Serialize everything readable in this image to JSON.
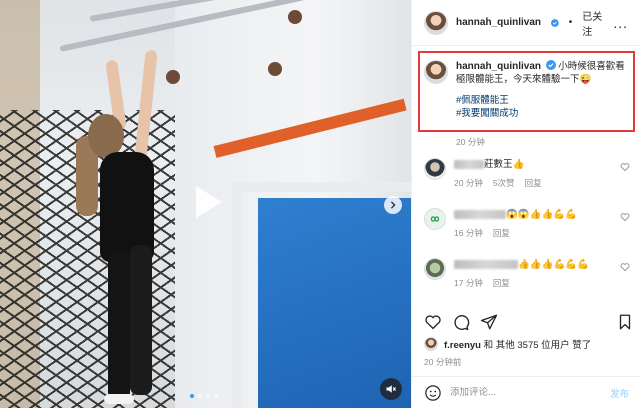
{
  "header": {
    "username": "hannah_quinlivan",
    "separator": "•",
    "follow_status": "已关注",
    "more": "..."
  },
  "caption": {
    "username": "hannah_quinlivan",
    "text": "小時候很喜歡看極限體能王，今天來體驗一下😜",
    "hashtags": [
      "#佩服體能王",
      "#我要闖關成功"
    ],
    "time": "20 分钟"
  },
  "comments": [
    {
      "text_suffix": "莊數王👍",
      "time": "20 分钟",
      "likes": "5次赞",
      "reply": "回复"
    },
    {
      "text_suffix": "😱😱👍👍💪💪",
      "time": "16 分钟",
      "reply": "回复"
    },
    {
      "text_suffix": "👍👍👍💪💪💪",
      "time": "17 分钟",
      "reply": "回复"
    }
  ],
  "likes": {
    "liker": "f.reenyu",
    "text": "和 其他 3575 位用户 赞了"
  },
  "post_time": "20 分钟前",
  "composer": {
    "placeholder": "添加评论...",
    "post_label": "发布"
  }
}
